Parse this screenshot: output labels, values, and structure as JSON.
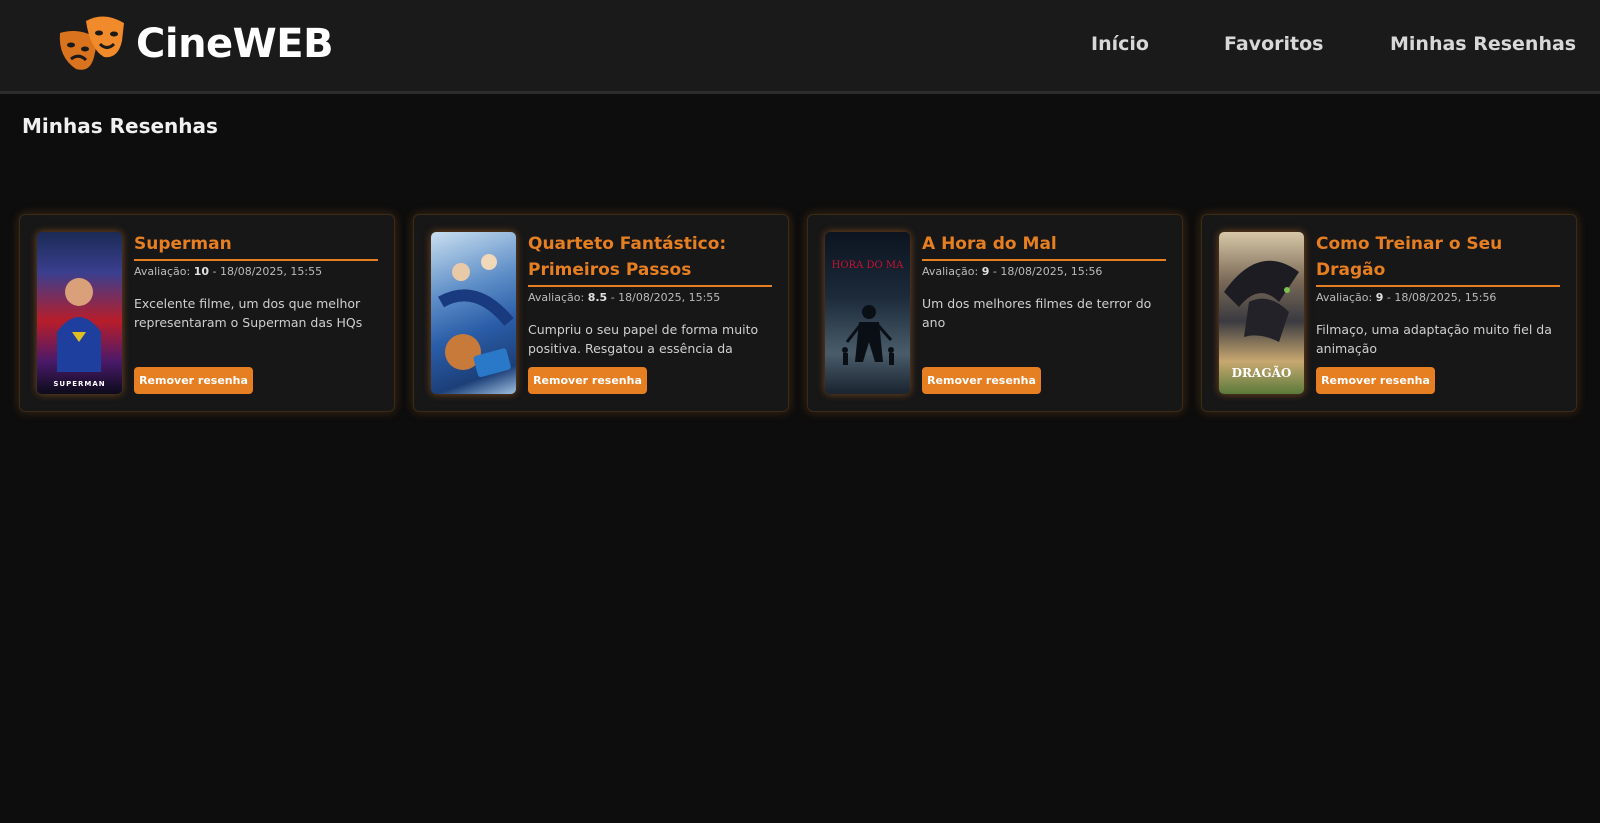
{
  "header": {
    "brand": "CineWEB",
    "logo_icon": "theater-masks-icon",
    "nav": [
      {
        "label": "Início"
      },
      {
        "label": "Favoritos"
      },
      {
        "label": "Minhas Resenhas"
      }
    ]
  },
  "page": {
    "title": "Minhas Resenhas"
  },
  "reviews": [
    {
      "title": "Superman",
      "rating_label": "Avaliação:",
      "rating": "10",
      "date": "- 18/08/2025, 15:55",
      "text": "Excelente filme, um dos que melhor representaram o Superman das HQs",
      "remove_label": "Remover resenha",
      "poster_caption": "SUPERMAN"
    },
    {
      "title": "Quarteto Fantástico: Primeiros Passos",
      "rating_label": "Avaliação:",
      "rating": "8.5",
      "date": "- 18/08/2025, 15:55",
      "text": "Cumpriu o seu papel de forma muito positiva. Resgatou a essência da Marvel",
      "remove_label": "Remover resenha"
    },
    {
      "title": "A Hora do Mal",
      "rating_label": "Avaliação:",
      "rating": "9",
      "date": "- 18/08/2025, 15:56",
      "text": "Um dos melhores filmes de terror do ano",
      "remove_label": "Remover resenha",
      "poster_caption": "HORA DO MA"
    },
    {
      "title": "Como Treinar o Seu Dragão",
      "rating_label": "Avaliação:",
      "rating": "9",
      "date": "- 18/08/2025, 15:56",
      "text": "Filmaço, uma adaptação muito fiel da animação",
      "remove_label": "Remover resenha",
      "poster_caption": "DRAGÃO"
    }
  ],
  "colors": {
    "accent": "#e67e22",
    "background": "#0d0d0d",
    "header": "#1a1a1a",
    "card": "#171717"
  }
}
